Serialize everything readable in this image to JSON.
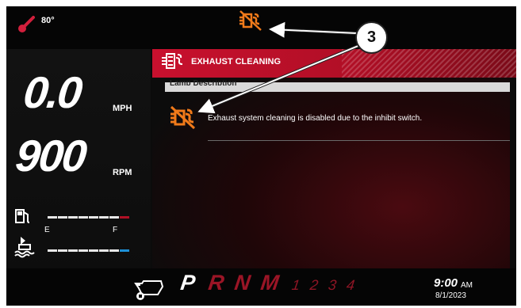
{
  "top": {
    "temperature": "80°"
  },
  "speed": {
    "value": "0.0",
    "unit": "MPH"
  },
  "rpm": {
    "value": "900",
    "unit": "RPM"
  },
  "fuel_gauge": {
    "level": 0.86,
    "segments": 8
  },
  "def_gauge": {
    "empty_label": "E",
    "full_label": "F",
    "level": 1.0,
    "segments": 8
  },
  "panel": {
    "title": "EXHAUST CLEANING",
    "section_label": "Lamp Description",
    "row_text": "Exhaust system cleaning is disabled due to the inhibit switch."
  },
  "transmission": {
    "gears": [
      "P",
      "R",
      "N",
      "M"
    ],
    "numbers": "1 2 3 4",
    "selected": "P"
  },
  "clock": {
    "time": "9:00",
    "ampm": "AM",
    "date": "8/1/2023"
  },
  "callout": {
    "number": "3"
  },
  "colors": {
    "accent_red": "#c8102e",
    "icon_orange": "#f07a1a",
    "def_blue": "#1e90d6"
  }
}
